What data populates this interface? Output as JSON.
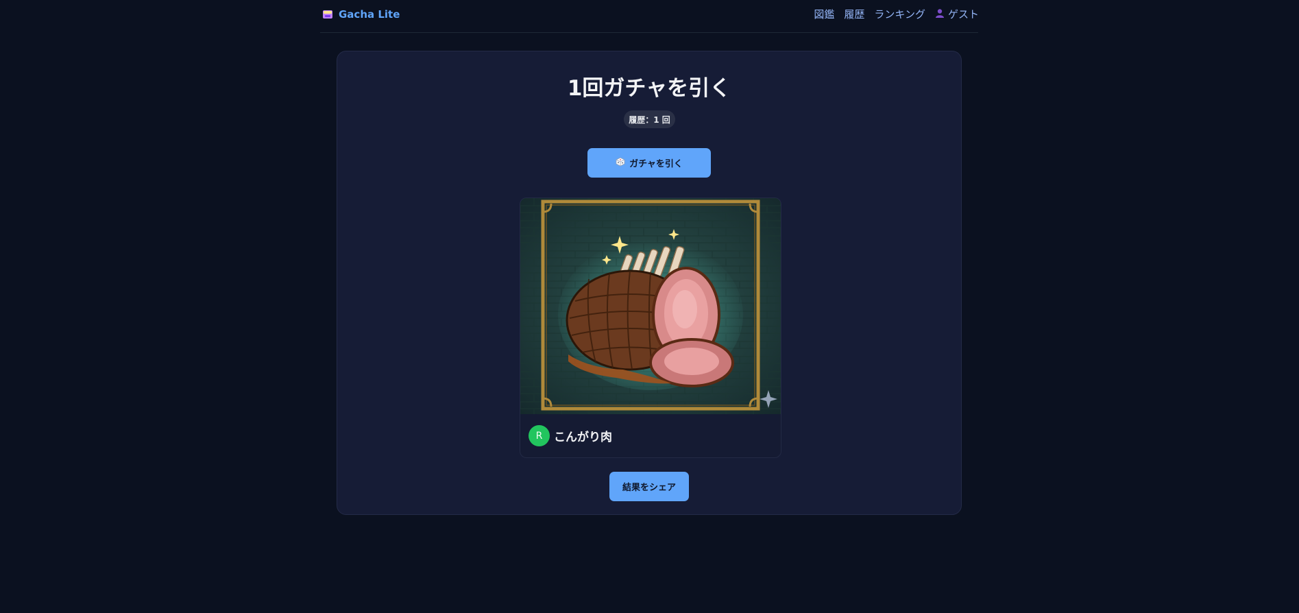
{
  "header": {
    "brand": "Gacha Lite",
    "nav": {
      "catalog": "図鑑",
      "history": "履歴",
      "ranking": "ランキング",
      "user": "ゲスト"
    }
  },
  "main": {
    "title": "1回ガチャを引く",
    "history_badge": "履歴：1 回",
    "draw_button": "ガチャを引く",
    "result": {
      "rarity": "R",
      "name": "こんがり肉"
    },
    "share_button": "結果をシェア"
  },
  "colors": {
    "accent": "#60a5fa",
    "rarity_r": "#22c55e",
    "background": "#0b1120",
    "panel": "#161c36"
  },
  "icons": {
    "brand": "gacha-machine-icon",
    "user": "user-silhouette-icon",
    "draw": "dice-icon"
  }
}
